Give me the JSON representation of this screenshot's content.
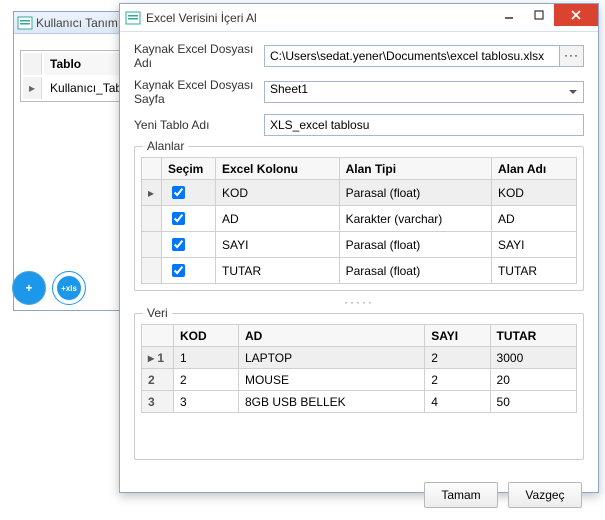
{
  "bgWindow": {
    "title": "Kullanıcı Tanım",
    "gridHeader": "Tablo",
    "gridRow": "Kullanıcı_Tablos",
    "btnPlus": "+",
    "btnXls": "+xls"
  },
  "modal": {
    "title": "Excel Verisini İçeri Al",
    "labels": {
      "srcFile": "Kaynak Excel Dosyası Adı",
      "srcSheet": "Kaynak Excel Dosyası Sayfa",
      "newTable": "Yeni Tablo Adı"
    },
    "values": {
      "srcFile": "C:\\Users\\sedat.yener\\Documents\\excel tablosu.xlsx",
      "srcSheet": "Sheet1",
      "newTable": "XLS_excel tablosu"
    },
    "browse": "···"
  },
  "alanlar": {
    "title": "Alanlar",
    "headers": {
      "secim": "Seçim",
      "excelKolonu": "Excel Kolonu",
      "alanTipi": "Alan Tipi",
      "alanAdi": "Alan Adı"
    },
    "rows": [
      {
        "secim": true,
        "excelKolonu": "KOD",
        "alanTipi": "Parasal (float)",
        "alanAdi": "KOD",
        "selected": true
      },
      {
        "secim": true,
        "excelKolonu": "AD",
        "alanTipi": "Karakter (varchar)",
        "alanAdi": "AD",
        "selected": false
      },
      {
        "secim": true,
        "excelKolonu": "SAYI",
        "alanTipi": "Parasal (float)",
        "alanAdi": "SAYI",
        "selected": false
      },
      {
        "secim": true,
        "excelKolonu": "TUTAR",
        "alanTipi": "Parasal (float)",
        "alanAdi": "TUTAR",
        "selected": false
      }
    ]
  },
  "veri": {
    "title": "Veri",
    "headers": {
      "kod": "KOD",
      "ad": "AD",
      "sayi": "SAYI",
      "tutar": "TUTAR"
    },
    "rows": [
      {
        "n": "1",
        "kod": "1",
        "ad": "LAPTOP",
        "sayi": "2",
        "tutar": "3000",
        "selected": true
      },
      {
        "n": "2",
        "kod": "2",
        "ad": "MOUSE",
        "sayi": "2",
        "tutar": "20",
        "selected": false
      },
      {
        "n": "3",
        "kod": "3",
        "ad": "8GB USB BELLEK",
        "sayi": "4",
        "tutar": "50",
        "selected": false
      }
    ]
  },
  "buttons": {
    "ok": "Tamam",
    "cancel": "Vazgeç"
  },
  "dots": "·····"
}
